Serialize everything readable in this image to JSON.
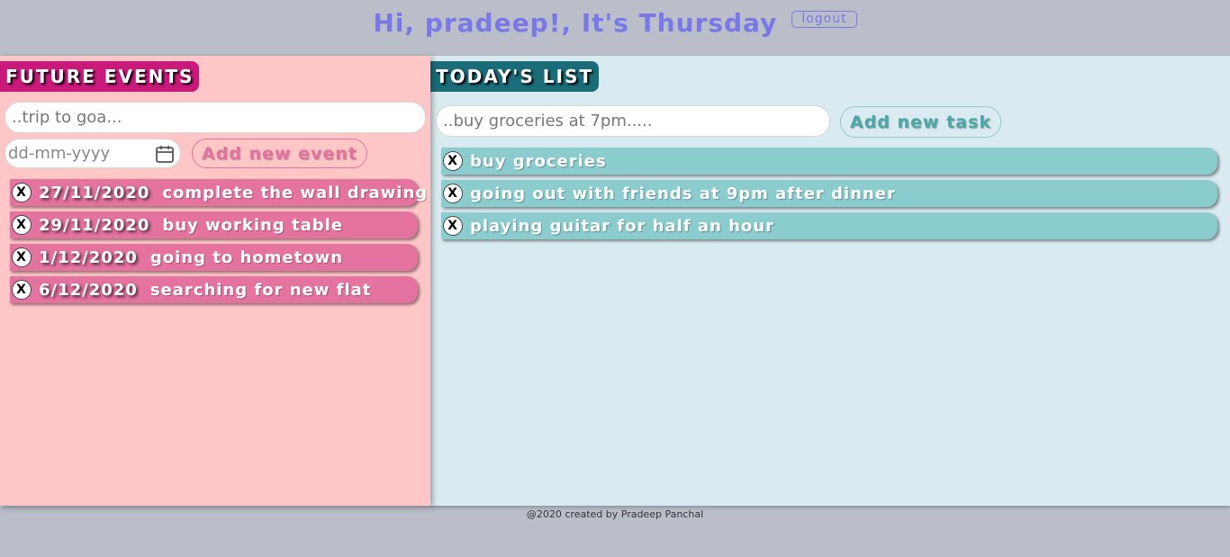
{
  "header": {
    "greeting": "Hi, pradeep!, It's Thursday",
    "logout_label": "logout"
  },
  "future_events": {
    "title": "FUTURE EVENTS",
    "event_placeholder": "..trip to goa...",
    "date_placeholder": "dd-mm-yyyy",
    "add_button_label": "Add new event",
    "items": [
      {
        "date": "27/11/2020",
        "text": "complete the wall drawing"
      },
      {
        "date": "29/11/2020",
        "text": "buy working table"
      },
      {
        "date": "1/12/2020",
        "text": "going to hometown"
      },
      {
        "date": "6/12/2020",
        "text": "searching for new flat"
      }
    ]
  },
  "todays_list": {
    "title": "TODAY'S LIST",
    "task_placeholder": "..buy groceries at 7pm.....",
    "add_button_label": "Add new task",
    "items": [
      {
        "text": "buy groceries"
      },
      {
        "text": "going out with friends at 9pm after dinner"
      },
      {
        "text": "playing guitar for half an hour"
      }
    ]
  },
  "remove_label": "X",
  "footer": {
    "text": "@2020 created by Pradeep Panchal"
  },
  "colors": {
    "background": "#babec9",
    "accent_purple": "#7a78e6",
    "events_panel": "#ffc6c7",
    "events_accent": "#e5739f",
    "today_panel": "#d9ebf0",
    "today_accent": "#8bcdcf"
  }
}
